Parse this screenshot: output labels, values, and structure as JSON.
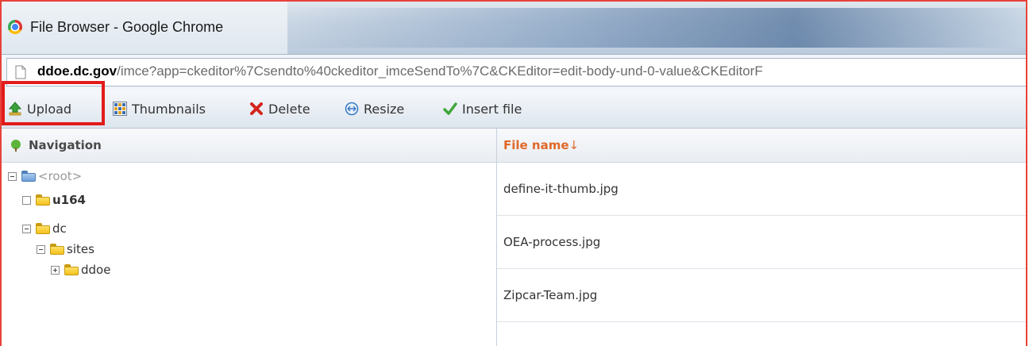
{
  "window": {
    "title": "File Browser - Google Chrome"
  },
  "address_bar": {
    "host": "ddoe.dc.gov",
    "path": "/imce?app=ckeditor%7Csendto%40ckeditor_imceSendTo%7C&CKEditor=edit-body-und-0-value&CKEditorF"
  },
  "toolbar": {
    "buttons": [
      {
        "label": "Upload",
        "icon": "upload-icon"
      },
      {
        "label": "Thumbnails",
        "icon": "thumbnails-icon"
      },
      {
        "label": "Delete",
        "icon": "delete-icon"
      },
      {
        "label": "Resize",
        "icon": "resize-icon"
      },
      {
        "label": "Insert file",
        "icon": "checkmark-icon"
      }
    ],
    "highlighted": "Upload",
    "highlight_color": "#e21b1b"
  },
  "navigation": {
    "title": "Navigation",
    "tree": [
      {
        "label": "<root>",
        "expanded": true
      },
      {
        "label": "u164",
        "expanded": false,
        "bold": true
      },
      {
        "label": "dc",
        "expanded": true
      },
      {
        "label": "sites",
        "expanded": true
      },
      {
        "label": "ddoe",
        "expanded": false
      }
    ]
  },
  "files": {
    "header": "File name",
    "sort_indicator": "↓",
    "header_color": "#e0692a",
    "rows": [
      {
        "name": "define-it-thumb.jpg"
      },
      {
        "name": "OEA-process.jpg"
      },
      {
        "name": "Zipcar-Team.jpg"
      }
    ]
  }
}
